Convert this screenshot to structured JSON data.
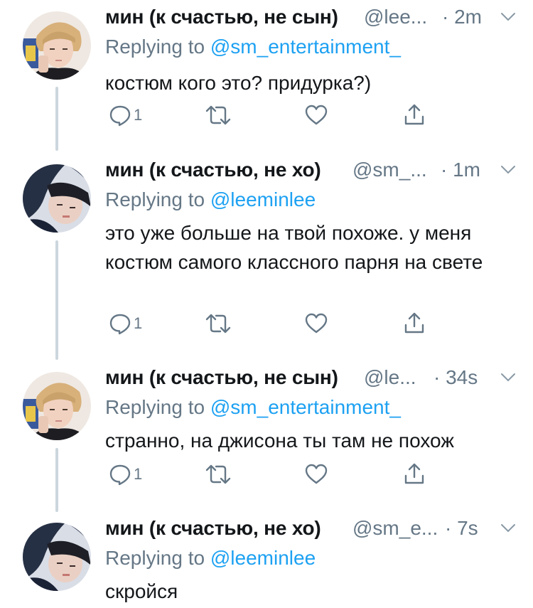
{
  "tweets": [
    {
      "name": "мин (к счастью, не сын)",
      "handle": "@lee...",
      "time": "· 2m",
      "replying_label": "Replying to ",
      "replying_to": "@sm_entertainment_",
      "text": "костюм кого это? придурка?)",
      "reply_count": "1",
      "avatar": "avatar-boy-blonde"
    },
    {
      "name": "мин (к счастью, не хо)",
      "handle": "@sm_...",
      "time": "· 1m",
      "replying_label": "Replying to ",
      "replying_to": "@leeminlee",
      "text": "это уже больше на твой похоже. у меня костюм самого классного парня на свете",
      "reply_count": "1",
      "avatar": "avatar-boy-dark"
    },
    {
      "name": "мин (к счастью, не сын)",
      "handle": "@le...",
      "time": "· 34s",
      "replying_label": "Replying to ",
      "replying_to": "@sm_entertainment_",
      "text": "странно, на джисона ты там не похож",
      "reply_count": "1",
      "avatar": "avatar-boy-blonde"
    },
    {
      "name": "мин (к счастью, не хо)",
      "handle": "@sm_e...",
      "time": "· 7s",
      "replying_label": "Replying to ",
      "replying_to": "@leeminlee",
      "text": "скройся",
      "reply_count": "",
      "avatar": "avatar-boy-dark"
    }
  ],
  "colors": {
    "text": "#14171a",
    "secondary": "#657786",
    "link": "#1da1f2",
    "thread_line": "#ccd6dd"
  }
}
